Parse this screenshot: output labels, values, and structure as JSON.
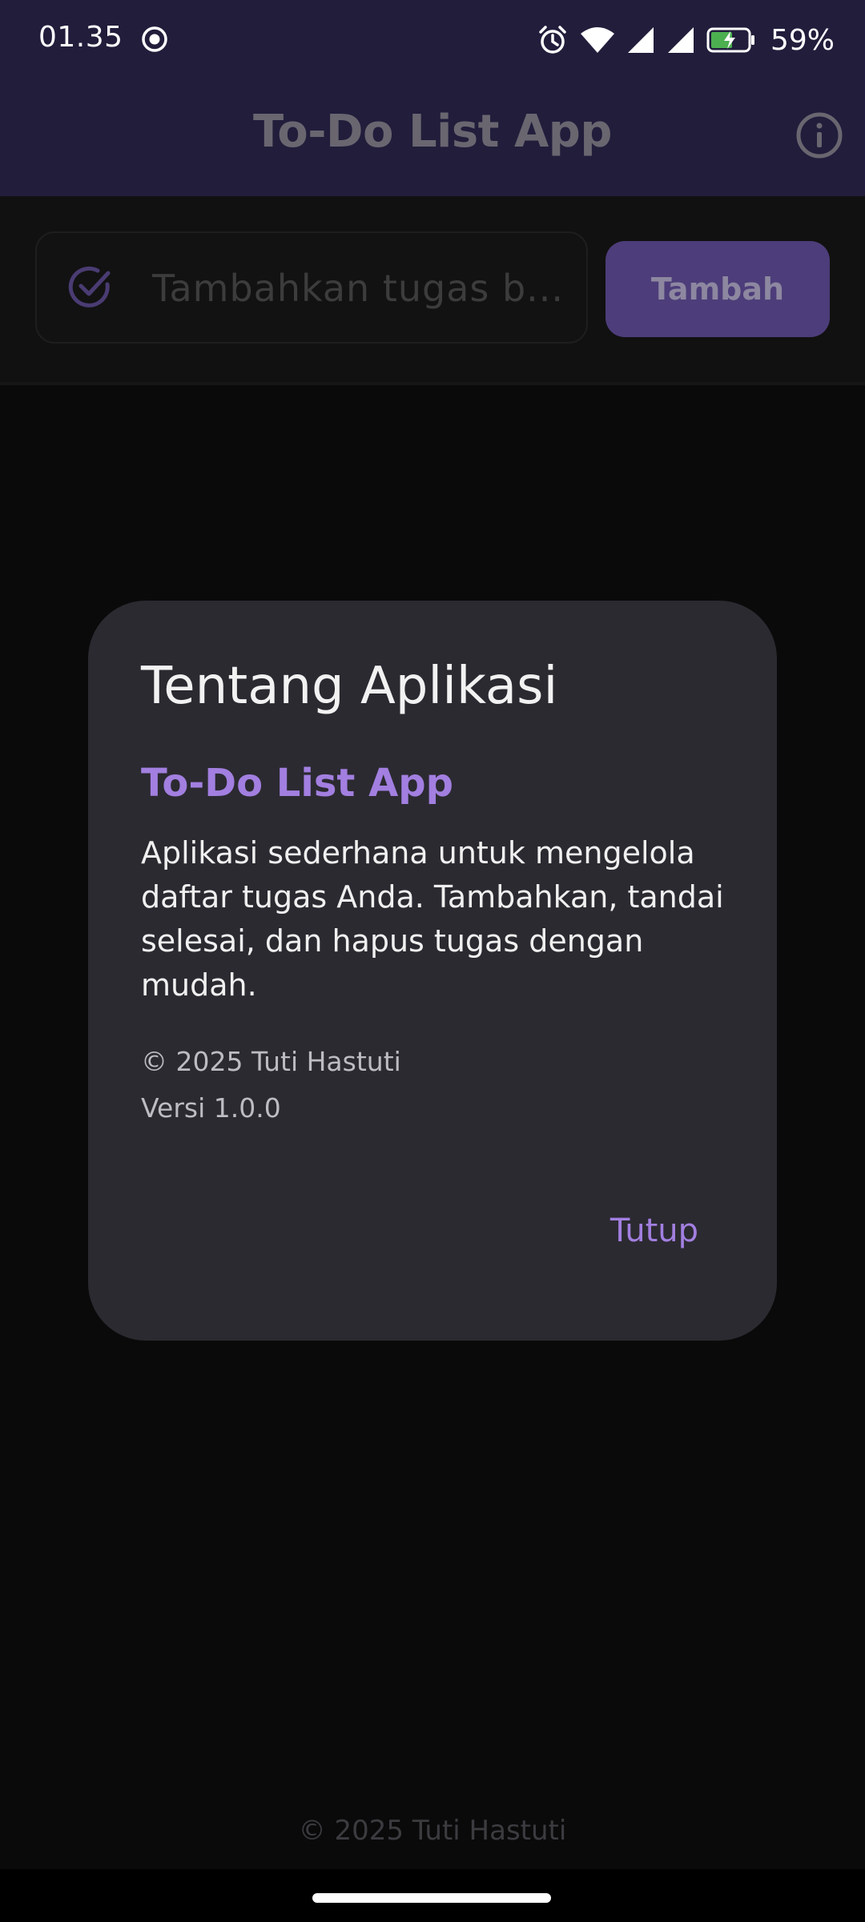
{
  "status_bar": {
    "time": "01.35",
    "battery_percent": "59%"
  },
  "app_bar": {
    "title": "To-Do List App"
  },
  "input": {
    "placeholder": "Tambahkan tugas b...",
    "add_button_label": "Tambah"
  },
  "dialog": {
    "title": "Tentang Aplikasi",
    "app_name": "To-Do List App",
    "description": "Aplikasi sederhana untuk mengelola daftar tugas Anda. Tambahkan, tandai selesai, dan hapus tugas dengan mudah.",
    "copyright": "© 2025 Tuti Hastuti",
    "version": "Versi 1.0.0",
    "close_label": "Tutup"
  },
  "footer": {
    "text": "© 2025 Tuti Hastuti"
  },
  "colors": {
    "app_bar": "#211d3b",
    "accent": "#a27fe0",
    "dialog_bg": "#2b2a31",
    "add_button": "#4d3d7a"
  },
  "icons": {
    "info": "info-icon",
    "check": "check-circle-icon",
    "alarm": "alarm-icon",
    "wifi": "wifi-icon",
    "signal": "signal-icon",
    "battery": "battery-charging-icon"
  }
}
